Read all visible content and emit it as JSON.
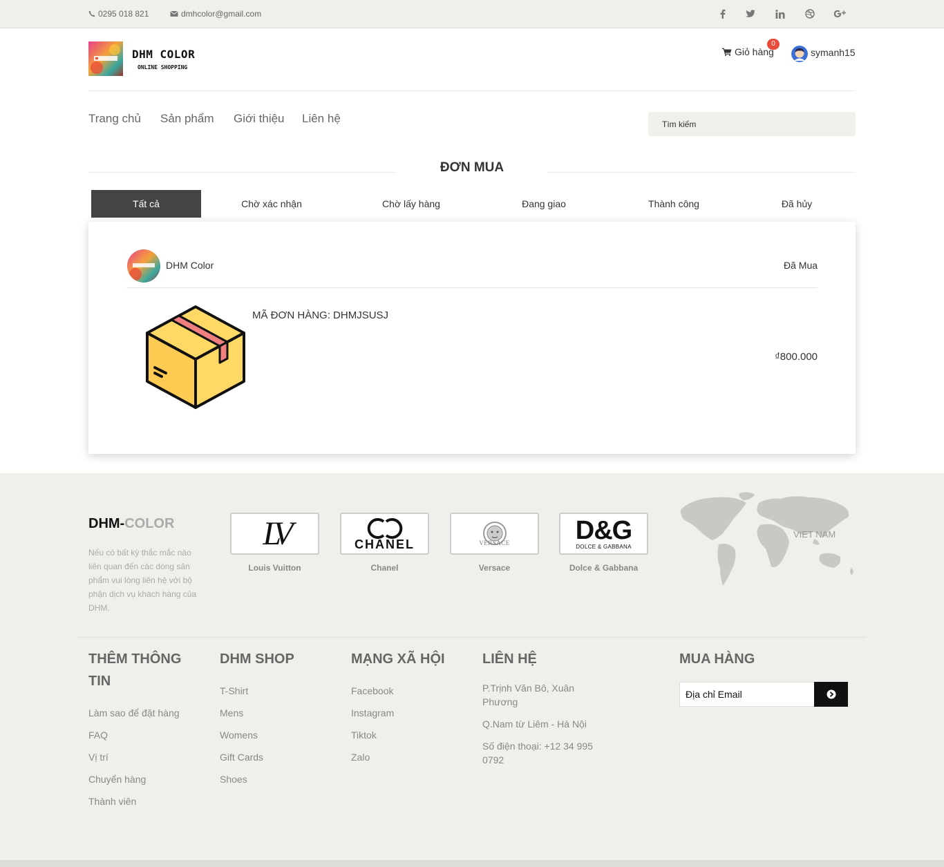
{
  "topbar": {
    "phone": "0295 018 821",
    "email": "dmhcolor@gmail.com",
    "social_icons": [
      "facebook-icon",
      "twitter-icon",
      "linkedin-icon",
      "dribbble-icon",
      "google-plus-icon"
    ]
  },
  "header": {
    "logo_title": "DHM COLOR",
    "logo_subtitle": "ONLINE SHOPPING",
    "cart_label": "Giỏ hàng",
    "cart_count": "0",
    "username": "symanh15"
  },
  "nav": {
    "items": [
      "Trang chủ",
      "Sản phẩm",
      "Giới thiệu",
      "Liên hệ"
    ],
    "search_placeholder": "Tìm kiếm"
  },
  "page": {
    "title": "ĐƠN MUA",
    "tabs": [
      "Tất cả",
      "Chờ xác nhận",
      "Chờ lấy hàng",
      "Đang giao",
      "Thành công",
      "Đã hủy"
    ],
    "active_tab": 0
  },
  "order": {
    "shop_name": "DHM Color",
    "status": "Đã Mua",
    "code": "MÃ ĐƠN HÀNG: DHMJSUSJ",
    "price": "₫800.000"
  },
  "footer": {
    "brand_part1": "DHM-",
    "brand_part2": "COLOR",
    "description": "Nếu có bất kỳ thắc mắc nào liên quan đến các dòng sản phẩm vui lòng liên hệ với bộ phận dịch vụ khách hàng của DHM.",
    "brands": [
      {
        "logo": "LV",
        "name": "Louis Vuitton"
      },
      {
        "logo": "CHANEL",
        "name": "Chanel"
      },
      {
        "logo": "VERSACE",
        "name": "Versace"
      },
      {
        "logo": "D&G",
        "logo_sub": "DOLCE & GABBANA",
        "name": "Dolce & Gabbana"
      }
    ],
    "map_label": "VIET NAM",
    "columns": {
      "info": {
        "title": "THÊM THÔNG TIN",
        "links": [
          "Làm sao để đặt hàng",
          "FAQ",
          "Vị trí",
          "Chuyển hàng",
          "Thành viên"
        ]
      },
      "shop": {
        "title": "DHM SHOP",
        "links": [
          "T-Shirt",
          "Mens",
          "Womens",
          "Gift Cards",
          "Shoes"
        ]
      },
      "social": {
        "title": "MẠNG XÃ HỘI",
        "links": [
          "Facebook",
          "Instagram",
          "Tiktok",
          "Zalo"
        ]
      },
      "contact": {
        "title": "LIÊN HỆ",
        "lines": [
          "P.Trịnh Văn Bô, Xuân Phương",
          "Q.Nam từ Liêm - Hà Nội",
          "Số điện thoại: +12 34 995 0792"
        ]
      },
      "buy": {
        "title": "MUA HÀNG",
        "email_placeholder": "Địa chỉ Email"
      }
    }
  },
  "colors": {
    "topbar_bg": "#f0efea",
    "active_tab_bg": "#444444",
    "badge": "#e74c3c",
    "footer_bg": "#f0efea"
  }
}
